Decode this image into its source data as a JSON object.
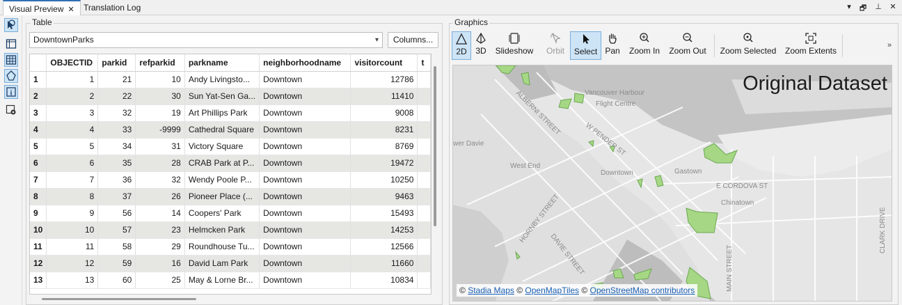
{
  "tabs": [
    {
      "label": "Visual Preview",
      "close": "✕"
    },
    {
      "label": "Translation Log"
    }
  ],
  "window_controls": [
    "▾",
    "🗗",
    "⊥",
    "✕"
  ],
  "left_tools": [
    "select-tool-icon",
    "layout-icon",
    "table-icon",
    "feature-icon",
    "info-icon",
    "settings-icon"
  ],
  "table_panel": {
    "label": "Table",
    "dataset": "DowntownParks",
    "columns_button": "Columns...",
    "headers": [
      "",
      "OBJECTID",
      "parkid",
      "refparkid",
      "parkname",
      "neighborhoodname",
      "visitorcount",
      "t"
    ],
    "rows": [
      [
        "1",
        "1",
        "21",
        "10",
        "Andy Livingsto...",
        "Downtown",
        "12786"
      ],
      [
        "2",
        "2",
        "22",
        "30",
        "Sun Yat-Sen Ga...",
        "Downtown",
        "11410"
      ],
      [
        "3",
        "3",
        "32",
        "19",
        "Art Phillips Park",
        "Downtown",
        "9008"
      ],
      [
        "4",
        "4",
        "33",
        "-9999",
        "Cathedral Square",
        "Downtown",
        "8231"
      ],
      [
        "5",
        "5",
        "34",
        "31",
        "Victory Square",
        "Downtown",
        "8769"
      ],
      [
        "6",
        "6",
        "35",
        "28",
        "CRAB Park at P...",
        "Downtown",
        "19472"
      ],
      [
        "7",
        "7",
        "36",
        "32",
        "Wendy Poole P...",
        "Downtown",
        "10250"
      ],
      [
        "8",
        "8",
        "37",
        "26",
        "Pioneer Place (...",
        "Downtown",
        "9463"
      ],
      [
        "9",
        "9",
        "56",
        "14",
        "Coopers' Park",
        "Downtown",
        "15493"
      ],
      [
        "10",
        "10",
        "57",
        "23",
        "Helmcken Park",
        "Downtown",
        "14253"
      ],
      [
        "11",
        "11",
        "58",
        "29",
        "Roundhouse Tu...",
        "Downtown",
        "12566"
      ],
      [
        "12",
        "12",
        "59",
        "16",
        "David Lam Park",
        "Downtown",
        "11660"
      ],
      [
        "13",
        "13",
        "60",
        "25",
        "May & Lorne Br...",
        "Downtown",
        "10834"
      ]
    ]
  },
  "graphics_panel": {
    "label": "Graphics",
    "toolbar": [
      {
        "label": "2D",
        "icon": "triangle-2d-icon",
        "selected": true
      },
      {
        "label": "3D",
        "icon": "pyramid-3d-icon"
      },
      {
        "label": "Slideshow",
        "icon": "slideshow-icon"
      },
      {
        "label": "Orbit",
        "icon": "orbit-icon",
        "disabled": true
      },
      {
        "label": "Select",
        "icon": "cursor-icon",
        "selected": true
      },
      {
        "label": "Pan",
        "icon": "hand-icon"
      },
      {
        "label": "Zoom In",
        "icon": "zoom-in-icon"
      },
      {
        "label": "Zoom Out",
        "icon": "zoom-out-icon"
      },
      {
        "label": "Zoom Selected",
        "icon": "zoom-selected-icon"
      },
      {
        "label": "Zoom Extents",
        "icon": "zoom-extents-icon"
      }
    ],
    "overflow": "»",
    "map_title": "Original Dataset",
    "map_labels": [
      "Vancouver Harbour",
      "Flight Centre",
      "ALBERNI STREET",
      "W PENDER ST",
      "West End",
      "Downtown",
      "Gastown",
      "E CORDOVA ST",
      "Chinatown",
      "HORNBY STREET",
      "DAVIE STREET",
      "MAIN STREET",
      "CLARK DRIVE",
      "wer Davie"
    ],
    "attribution": {
      "prefix": "©",
      "link1": "Stadia Maps",
      "link2": "OpenMapTiles",
      "link3": "OpenStreetMap contributors"
    }
  },
  "colors": {
    "park_fill": "#a6d785",
    "park_stroke": "#6aa84f",
    "water": "#bfbfbf",
    "land": "#e8e8e8",
    "accent": "#2f6fb4"
  }
}
